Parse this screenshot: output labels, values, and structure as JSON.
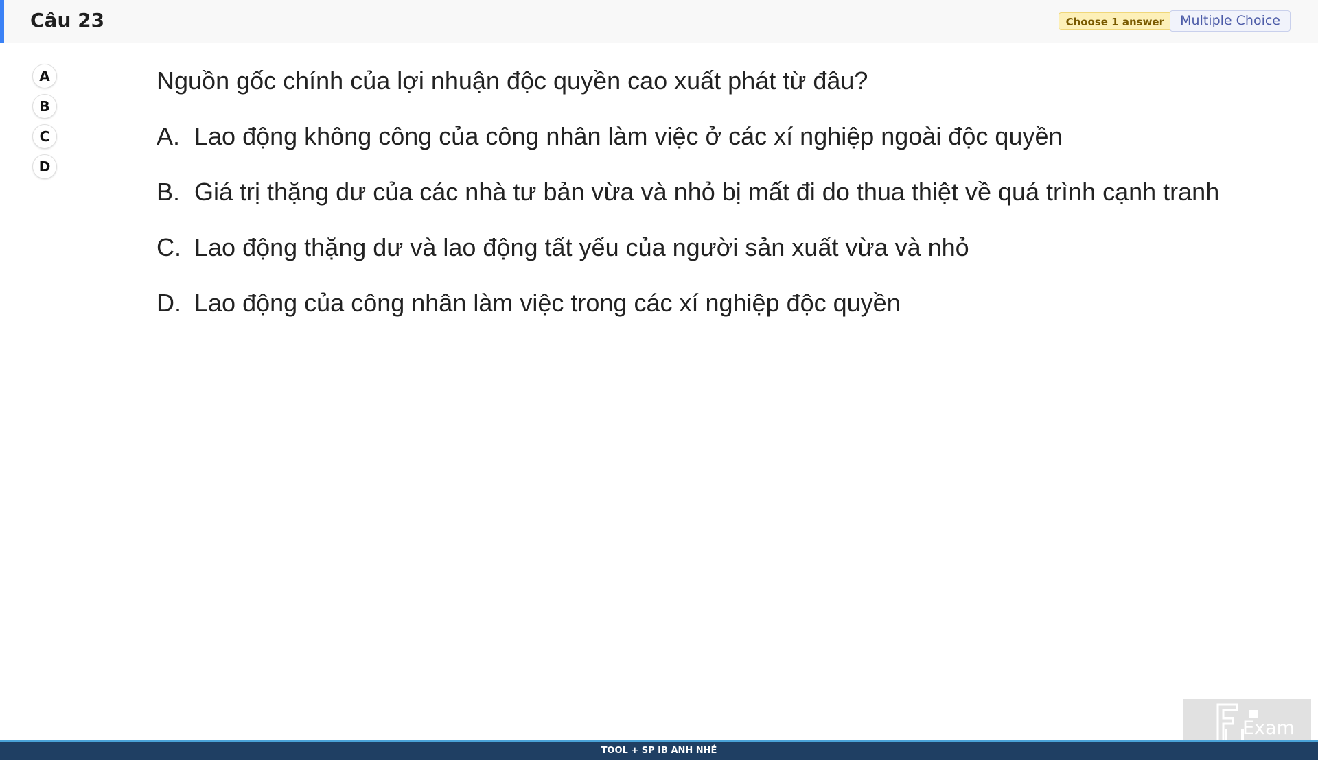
{
  "header": {
    "question_number": "Câu 23",
    "choose_badge": "Choose 1 answer",
    "type_badge": "Multiple Choice"
  },
  "answers": [
    "A",
    "B",
    "C",
    "D"
  ],
  "question": {
    "text": "Nguồn gốc chính của lợi nhuận độc quyền cao xuất phát từ đâu?",
    "options": [
      {
        "letter": "A.",
        "text": "Lao động không công của công nhân làm việc ở các xí nghiệp ngoài độc quyền"
      },
      {
        "letter": "B.",
        "text": "Giá trị thặng dư của các nhà tư bản vừa và nhỏ bị mất đi do thua thiệt về quá trình cạnh tranh"
      },
      {
        "letter": "C.",
        "text": "Lao động thặng dư và lao động tất yếu của người sản xuất vừa và nhỏ"
      },
      {
        "letter": "D.",
        "text": "Lao động của công nhân làm việc trong các xí nghiệp độc quyền"
      }
    ]
  },
  "footer": {
    "text": "TOOL + SP IB ANH NHÉ"
  },
  "logo": {
    "text": "Exam",
    "icon": "fu-exam-logo-icon"
  },
  "colors": {
    "accent": "#3b82f6",
    "footer_bg": "#1f3f63",
    "footer_border": "#4aa3d8",
    "choose_badge_bg": "#fdf0b8",
    "type_badge_text": "#4d5ca8"
  }
}
